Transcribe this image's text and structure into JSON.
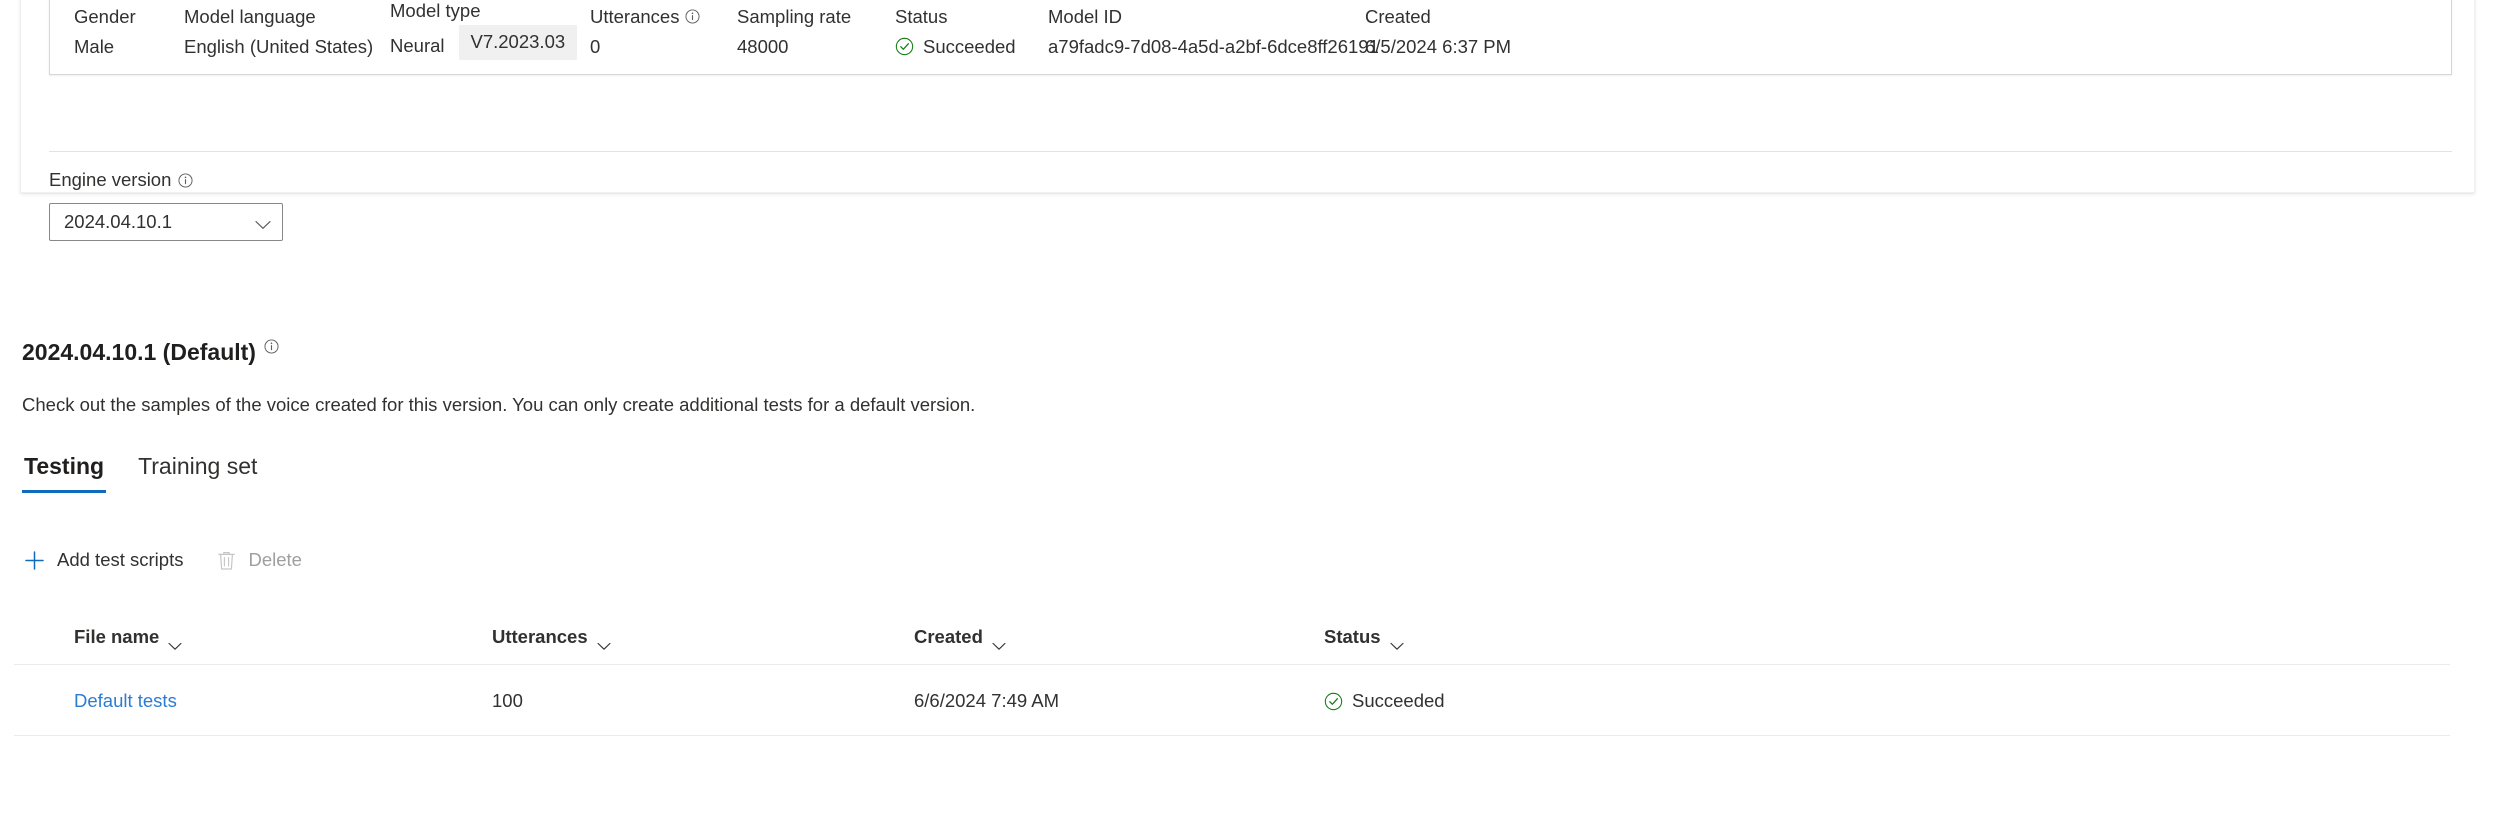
{
  "summary": {
    "fields": [
      {
        "label": "Gender",
        "value": "Male"
      },
      {
        "label": "Model language",
        "value": "English (United States)"
      },
      {
        "label": "Model type",
        "value": "Neural",
        "badge": "V7.2023.03"
      },
      {
        "label": "Utterances",
        "value": "0",
        "info": true
      },
      {
        "label": "Sampling rate",
        "value": "48000"
      },
      {
        "label": "Status",
        "value": "Succeeded",
        "status": "succeeded"
      },
      {
        "label": "Model ID",
        "value": "a79fadc9-7d08-4a5d-a2bf-6dce8ff26191"
      },
      {
        "label": "Created",
        "value": "6/5/2024 6:37 PM"
      }
    ]
  },
  "engine": {
    "label": "Engine version",
    "selected": "2024.04.10.1"
  },
  "version_section": {
    "heading": "2024.04.10.1 (Default)",
    "description": "Check out the samples of the voice created for this version. You can only create additional tests for a default version."
  },
  "tabs": [
    {
      "label": "Testing",
      "active": true
    },
    {
      "label": "Training set",
      "active": false
    }
  ],
  "commandbar": {
    "add_label": "Add test scripts",
    "delete_label": "Delete"
  },
  "table": {
    "columns": [
      {
        "label": "File name"
      },
      {
        "label": "Utterances"
      },
      {
        "label": "Created"
      },
      {
        "label": "Status"
      }
    ],
    "rows": [
      {
        "file_name": "Default tests",
        "utterances": "100",
        "created": "6/6/2024 7:49 AM",
        "status": "Succeeded"
      }
    ]
  },
  "colors": {
    "accent": "#0f6cbd",
    "link": "#2b7cd3",
    "success": "#107c10",
    "text": "#323130",
    "disabled": "#a19f9d"
  },
  "icons": {
    "info": "info-icon",
    "check": "check-circle-icon",
    "chevron": "chevron-down-icon",
    "plus": "plus-icon",
    "trash": "trash-icon"
  }
}
